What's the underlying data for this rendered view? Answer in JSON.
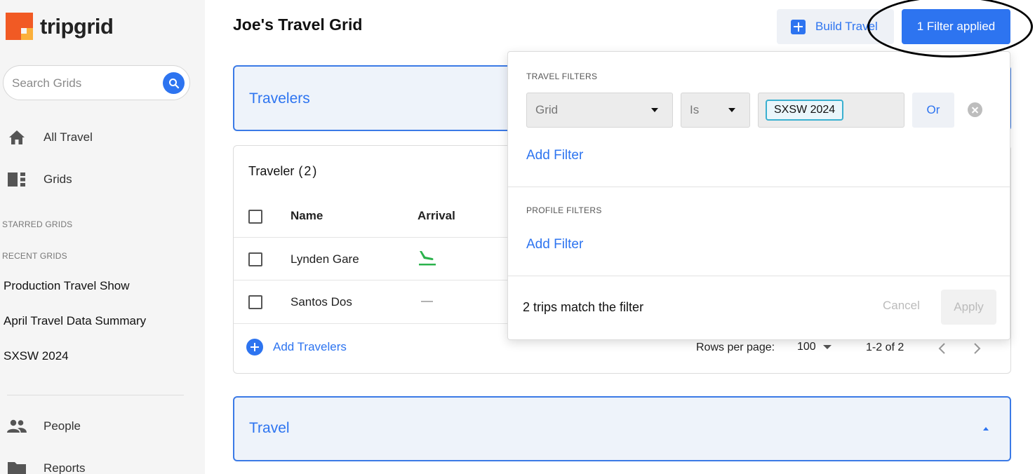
{
  "app": {
    "name": "tripgrid"
  },
  "sidebar": {
    "search": {
      "placeholder": "Search Grids"
    },
    "nav": [
      {
        "label": "All Travel",
        "icon": "home-icon"
      },
      {
        "label": "Grids",
        "icon": "grid-icon"
      }
    ],
    "starred_label": "STARRED GRIDS",
    "recent_label": "RECENT GRIDS",
    "recent": [
      "Production Travel Show",
      "April Travel Data Summary",
      "SXSW 2024"
    ],
    "bottom_nav": [
      {
        "label": "People",
        "icon": "people-icon"
      },
      {
        "label": "Reports",
        "icon": "folder-icon"
      }
    ]
  },
  "header": {
    "title": "Joe's Travel Grid",
    "build_label": "Build Travel",
    "filter_label": "1 Filter applied"
  },
  "travelers_panel": {
    "title": "Travelers"
  },
  "traveler_table": {
    "title": "Traveler",
    "count": "(2)",
    "columns": [
      "Name",
      "Arrival"
    ],
    "rows": [
      {
        "name": "Lynden Gare",
        "arrival": "flight-land-icon"
      },
      {
        "name": "Santos Dos",
        "arrival": "—"
      }
    ],
    "add_label": "Add Travelers",
    "rows_per_page_label": "Rows per page:",
    "rows_per_page": "100",
    "range": "1-2 of 2"
  },
  "travel_panel": {
    "title": "Travel"
  },
  "filter_popover": {
    "travel_filters_label": "TRAVEL FILTERS",
    "field": "Grid",
    "operator": "Is",
    "value_chip": "SXSW 2024",
    "or_label": "Or",
    "add_filter_label": "Add Filter",
    "profile_filters_label": "PROFILE FILTERS",
    "profile_add_filter_label": "Add Filter",
    "match_text": "2 trips match the filter",
    "cancel_label": "Cancel",
    "apply_label": "Apply"
  },
  "colors": {
    "accent": "#2d74f0",
    "logo_orange": "#f15a24",
    "logo_yellow": "#fbb03b",
    "arrival_green": "#2bb24c",
    "sidebar_bg": "#f5f5f5"
  }
}
